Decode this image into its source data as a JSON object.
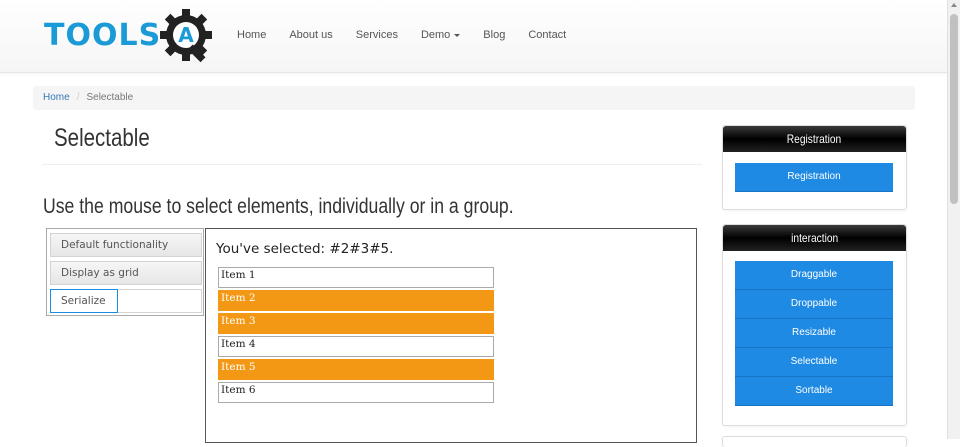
{
  "header": {
    "logo_text": "TOOLS",
    "logo_letter": "A",
    "nav": [
      {
        "label": "Home"
      },
      {
        "label": "About us"
      },
      {
        "label": "Services"
      },
      {
        "label": "Demo"
      },
      {
        "label": "Blog"
      },
      {
        "label": "Contact"
      }
    ]
  },
  "breadcrumb": {
    "home": "Home",
    "separator": "/",
    "current": "Selectable"
  },
  "page": {
    "title": "Selectable",
    "subtitle": "Use the mouse to select elements, individually or in a group."
  },
  "demo_tabs": [
    {
      "label": "Default functionality",
      "active": false
    },
    {
      "label": "Display as grid",
      "active": false
    },
    {
      "label": "Serialize",
      "active": true
    }
  ],
  "demo": {
    "selected_text": "You've selected: #2#3#5.",
    "items": [
      {
        "label": "Item 1",
        "selected": false
      },
      {
        "label": "Item 2",
        "selected": true
      },
      {
        "label": "Item 3",
        "selected": true
      },
      {
        "label": "Item 4",
        "selected": false
      },
      {
        "label": "Item 5",
        "selected": true
      },
      {
        "label": "Item 6",
        "selected": false
      }
    ]
  },
  "sidebar": {
    "registration": {
      "title": "Registration",
      "buttons": [
        {
          "label": "Registration"
        }
      ]
    },
    "interaction": {
      "title": "interaction",
      "buttons": [
        {
          "label": "Draggable"
        },
        {
          "label": "Droppable"
        },
        {
          "label": "Resizable"
        },
        {
          "label": "Selectable"
        },
        {
          "label": "Sortable"
        }
      ]
    }
  },
  "colors": {
    "logo_blue": "#1a9ad6",
    "selected_orange": "#f39814",
    "button_blue": "#1f8ae4",
    "link_blue": "#337ab7"
  }
}
